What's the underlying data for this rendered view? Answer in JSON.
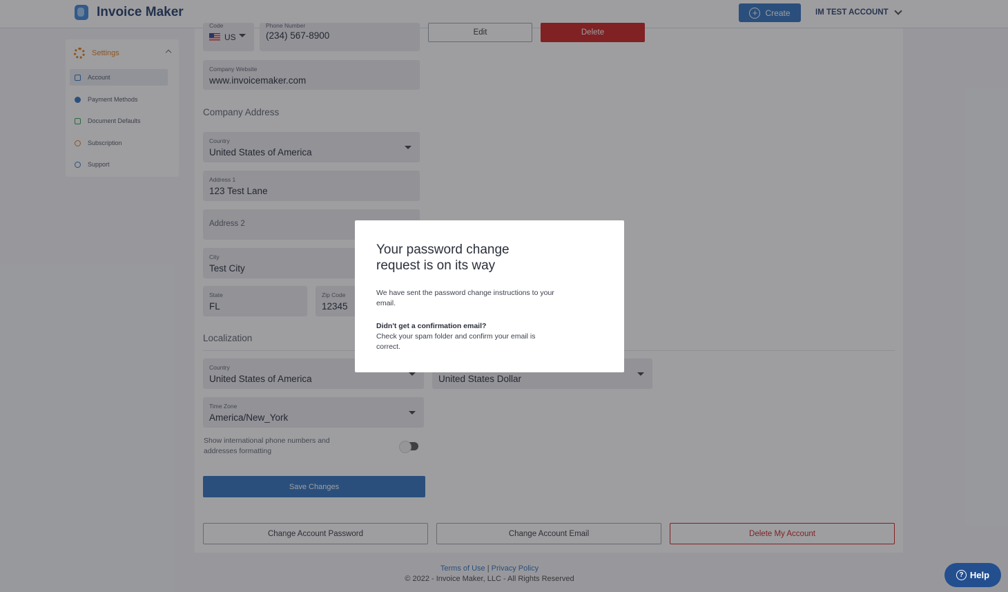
{
  "header": {
    "brand": "Invoice Maker",
    "create_label": "Create",
    "account_label": "IM TEST ACCOUNT"
  },
  "sidebar": {
    "heading": "Settings",
    "items": [
      {
        "label": "Account",
        "active": true
      },
      {
        "label": "Payment Methods"
      },
      {
        "label": "Document Defaults"
      },
      {
        "label": "Subscription"
      },
      {
        "label": "Support"
      }
    ]
  },
  "form": {
    "phone_code_label": "Code",
    "phone_code_value": "US",
    "phone_label": "Phone Number",
    "phone_value": "(234) 567-8900",
    "logo_edit_label": "Edit",
    "logo_delete_label": "Delete",
    "website_label": "Company Website",
    "website_value": "www.invoicemaker.com",
    "address_section": "Company Address",
    "country_label": "Country",
    "country_value": "United States of America",
    "address1_label": "Address 1",
    "address1_value": "123 Test Lane",
    "address2_placeholder": "Address 2",
    "city_label": "City",
    "city_value": "Test City",
    "state_label": "State",
    "state_value": "FL",
    "zip_label": "Zip Code",
    "zip_value": "12345",
    "localization_section": "Localization",
    "loc_country_label": "Country",
    "loc_country_value": "United States of America",
    "currency_value": "United States Dollar",
    "timezone_label": "Time Zone",
    "timezone_value": "America/New_York",
    "intl_toggle_label": "Show international phone numbers and addresses formatting",
    "save_label": "Save Changes"
  },
  "account_actions": {
    "change_password": "Change Account Password",
    "change_email": "Change Account Email",
    "delete_account": "Delete My Account"
  },
  "footer": {
    "terms": "Terms of Use",
    "separator": "|",
    "privacy": "Privacy Policy",
    "copyright": "© 2022 - Invoice Maker, LLC - All Rights Reserved"
  },
  "help_label": "Help",
  "modal": {
    "title": "Your password change request is on its way",
    "body": "We have sent the password change instructions to your email.",
    "subheading": "Didn't get a confirmation email?",
    "subbody": "Check your spam folder and confirm your email is correct."
  },
  "colors": {
    "primary": "#2c6fbd",
    "danger": "#c91c1c",
    "settings_accent": "#e07a1c"
  }
}
